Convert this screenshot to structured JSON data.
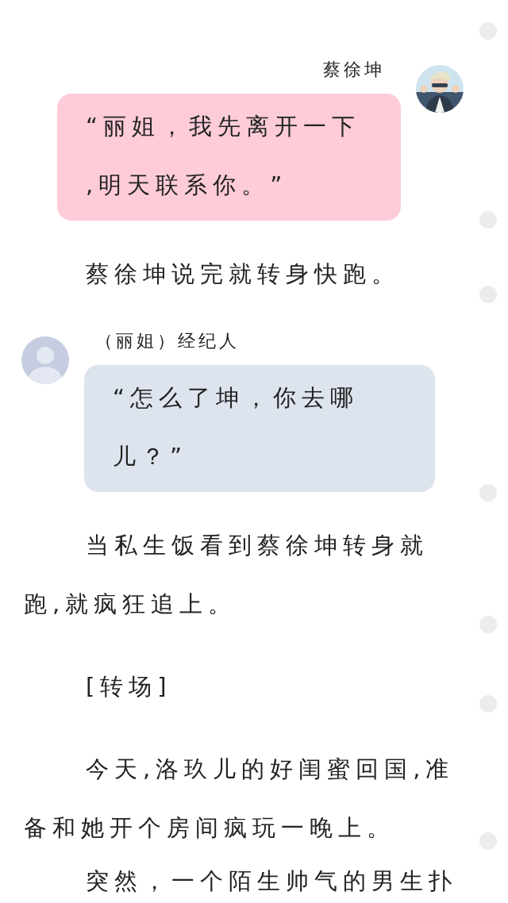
{
  "content": [
    {
      "kind": "outgoing",
      "speaker": "蔡徐坤",
      "color": "#fdccd8",
      "lines": [
        "“丽姐，我先离开一下",
        ",明天联系你。”"
      ]
    },
    {
      "kind": "paragraph",
      "lines": [
        "蔡徐坤说完就转身快跑。"
      ]
    },
    {
      "kind": "incoming",
      "speaker": "（丽姐）经纪人",
      "avatar": {
        "kind": "silhouette"
      },
      "color": "#dde4ee",
      "lines": [
        "“怎么了坤，你去哪",
        "儿？”"
      ]
    },
    {
      "kind": "paragraph",
      "lines": [
        "当私生饭看到蔡徐坤转身就",
        "跑,就疯狂追上。"
      ]
    },
    {
      "kind": "paragraph",
      "lines": [
        "[转场]"
      ]
    },
    {
      "kind": "paragraph",
      "lines": [
        "今天,洛玖儿的好闺蜜回国,准",
        "备和她开个房间疯玩一晚上。"
      ]
    },
    {
      "kind": "paragraph",
      "lines": [
        "突然，一个陌生帅气的男生扑"
      ]
    }
  ]
}
